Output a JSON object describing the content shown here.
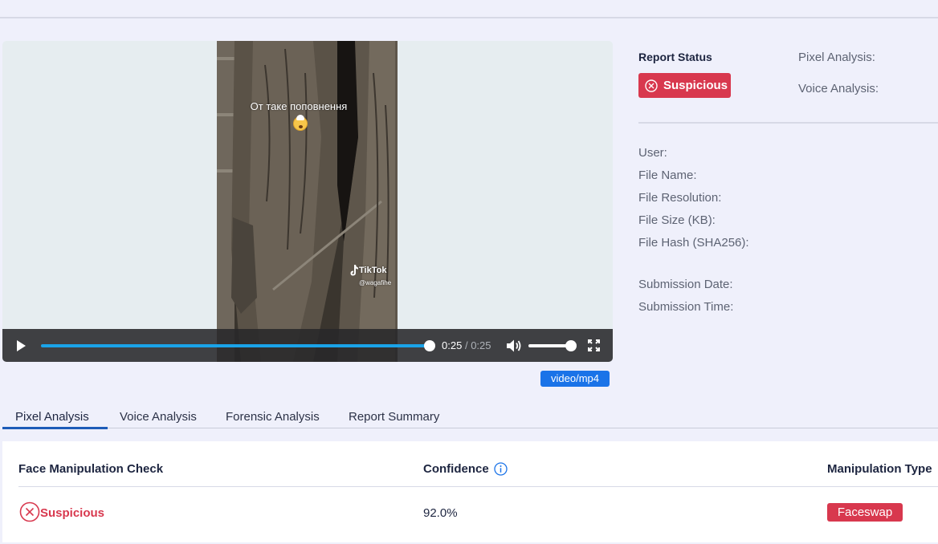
{
  "colors": {
    "accent": "#1a73e8",
    "danger": "#d8384e",
    "progress": "#1aa3e8",
    "background": "#eff0fb"
  },
  "video": {
    "caption": "От таке поповнення",
    "watermark": "TikTok",
    "watermark_handle": "@wagafihe",
    "current_time": "0:25",
    "separator": "/",
    "duration": "0:25",
    "progress_fraction": 1.0,
    "volume_fraction": 0.98,
    "mime_type": "video/mp4",
    "icons": [
      "play-icon",
      "volume-icon",
      "fullscreen-icon"
    ]
  },
  "report": {
    "status_label": "Report Status",
    "status_value": "Suspicious",
    "pixel_analysis_label": "Pixel Analysis:",
    "voice_analysis_label": "Voice Analysis:",
    "fields": {
      "user": "User:",
      "file_name": "File Name:",
      "file_resolution": "File Resolution:",
      "file_size": "File Size (KB):",
      "file_hash": "File Hash (SHA256):",
      "submission_date": "Submission Date:",
      "submission_time": "Submission Time:"
    }
  },
  "tabs": {
    "pixel": "Pixel Analysis",
    "voice": "Voice Analysis",
    "forensic": "Forensic Analysis",
    "summary": "Report Summary",
    "active": "Pixel Analysis"
  },
  "table": {
    "headers": {
      "check": "Face Manipulation Check",
      "confidence": "Confidence",
      "type": "Manipulation Type"
    },
    "rows": [
      {
        "result": "Suspicious",
        "confidence": "92.0%",
        "type": "Faceswap"
      }
    ]
  }
}
